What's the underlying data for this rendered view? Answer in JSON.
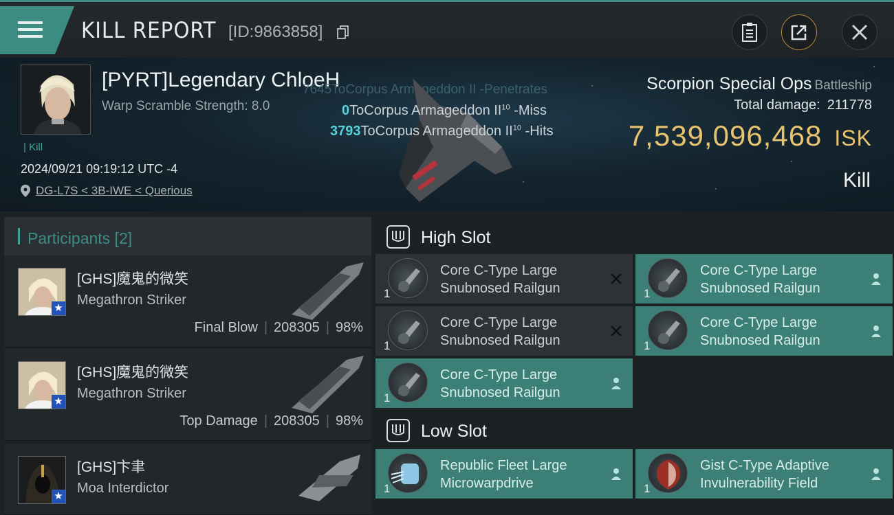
{
  "header": {
    "title": "KILL REPORT",
    "kill_id": "[ID:9863858]"
  },
  "banner": {
    "pilot_name": "[PYRT]Legendary ChloeH",
    "warp_scramble": "Warp Scramble Strength: 8.0",
    "kill_tag": "| Kill",
    "datetime": "2024/09/21 09:19:12 UTC -4",
    "location": "DG-L7S < 3B-IWE < Querious",
    "damage_ghost": "7645ToCorpus Armageddon II  -Penetrates",
    "damage_lines": [
      {
        "amount": "0",
        "text": "ToCorpus Armageddon II",
        "sup": "10",
        "result": " -Miss"
      },
      {
        "amount": "3793",
        "text": "ToCorpus Armageddon II",
        "sup": "10",
        "result": " -Hits"
      }
    ],
    "ship_name": "Scorpion Special Ops",
    "ship_class": "Battleship",
    "total_damage_label": "Total damage:",
    "total_damage": "211778",
    "isk_value": "7,539,096,468",
    "isk_unit": "ISK",
    "result": "Kill"
  },
  "participants": {
    "header": "Participants [2]",
    "list": [
      {
        "name": "[GHS]魔鬼的微笑",
        "ship": "Megathron Striker",
        "role": "Final Blow",
        "damage": "208305",
        "percent": "98%"
      },
      {
        "name": "[GHS]魔鬼的微笑",
        "ship": "Megathron Striker",
        "role": "Top Damage",
        "damage": "208305",
        "percent": "98%"
      },
      {
        "name": "[GHS]卞聿",
        "ship": "Moa Interdictor",
        "role": "",
        "damage": "",
        "percent": ""
      }
    ]
  },
  "slots": {
    "high_title": "High Slot",
    "low_title": "Low Slot",
    "high": [
      {
        "name": "Core C-Type Large Snubnosed Railgun",
        "qty": "1",
        "status": "destroyed"
      },
      {
        "name": "Core C-Type Large Snubnosed Railgun",
        "qty": "1",
        "status": "dropped"
      },
      {
        "name": "Core C-Type Large Snubnosed Railgun",
        "qty": "1",
        "status": "destroyed"
      },
      {
        "name": "Core C-Type Large Snubnosed Railgun",
        "qty": "1",
        "status": "dropped"
      },
      {
        "name": "Core C-Type Large Snubnosed Railgun",
        "qty": "1",
        "status": "dropped"
      }
    ],
    "low": [
      {
        "name": "Republic Fleet Large Microwarpdrive",
        "qty": "1",
        "status": "dropped"
      },
      {
        "name": "Gist C-Type Adaptive Invulnerability Field",
        "qty": "1",
        "status": "dropped"
      }
    ]
  },
  "colors": {
    "accent": "#3aa595",
    "isk": "#e7c26f",
    "damage_number": "#58d0d8",
    "dropped_bg": "#3b7f77"
  }
}
